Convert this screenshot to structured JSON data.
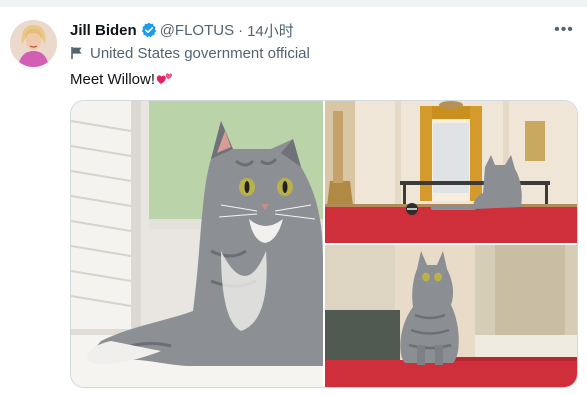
{
  "tweet": {
    "author_name": "Jill Biden",
    "handle": "@FLOTUS",
    "separator": "·",
    "time": "14小时",
    "more_label": "•••",
    "label_badge": "United States government official",
    "text": "Meet Willow!",
    "emoji": "two-hearts-emoji"
  },
  "icons": {
    "verified": "verified-badge-icon",
    "flag": "flag-icon",
    "more": "more-options-icon"
  },
  "colors": {
    "verified_blue": "#1d9bf0",
    "text_primary": "#0f1419",
    "text_secondary": "#536471",
    "red_carpet": "#cf2f3a",
    "cat_gray": "#8b8f93"
  }
}
